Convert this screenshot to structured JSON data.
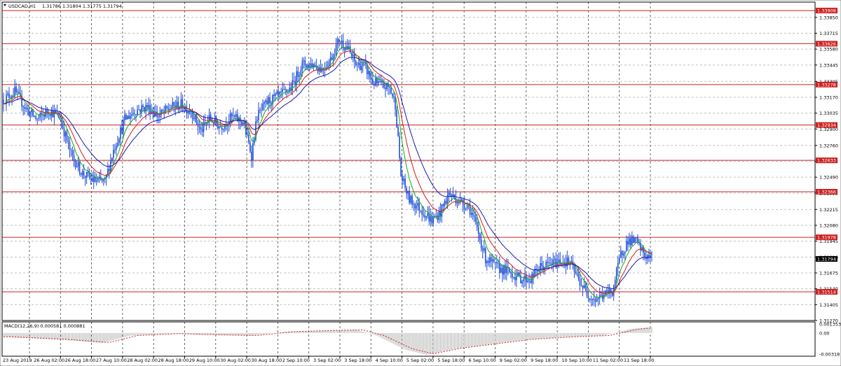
{
  "header": {
    "symbol_label": "USDCAD,H1",
    "ohlc_label": "1.31786 1.31804 1.31775 1.31794"
  },
  "macd": {
    "label": "MACD(12,26,9) 0.000581 0.000881",
    "ticks": [
      "0.001353",
      "0.00",
      "-0.00318"
    ]
  },
  "colors": {
    "background": "#ffffff",
    "frame": "#000000",
    "grid": "#c0c0c0",
    "candles": "#1f4fd8",
    "ma_fast": "#1aa51a",
    "ma_mid": "#d81c1c",
    "ma_slow": "#1b1bb0",
    "level_line": "#cc2020",
    "level_tag_bg": "#cc2020",
    "current_tag_bg": "#000000",
    "macd_hist": "#b8b8b8",
    "macd_signal": "#cc2020"
  },
  "chart_data": {
    "type": "candlestick",
    "title": "USDCAD,H1",
    "ylim": [
      1.3127,
      1.3398
    ],
    "price_ticks": [
      "1.33850",
      "1.33715",
      "1.33580",
      "1.33445",
      "1.33305",
      "1.33170",
      "1.33035",
      "1.32900",
      "1.32760",
      "1.32625",
      "1.32490",
      "1.32355",
      "1.32215",
      "1.32080",
      "1.31945",
      "1.31810",
      "1.31675",
      "1.31540",
      "1.31405",
      "1.31270"
    ],
    "levels": [
      "1.33908",
      "1.33626",
      "1.33278",
      "1.32934",
      "1.32633",
      "1.32366",
      "1.31978",
      "1.31514"
    ],
    "current_price": "1.31794",
    "x_labels": [
      "23 Aug 2019",
      "26 Aug 02:00",
      "26 Aug 18:00",
      "27 Aug 10:00",
      "28 Aug 02:00",
      "28 Aug 18:00",
      "29 Aug 10:00",
      "30 Aug 02:00",
      "30 Aug 18:00",
      "2 Sep 10:00",
      "3 Sep 02:00",
      "3 Sep 18:00",
      "4 Sep 10:00",
      "5 Sep 02:00",
      "5 Sep 18:00",
      "6 Sep 10:00",
      "9 Sep 02:00",
      "9 Sep 18:00",
      "10 Sep 10:00",
      "11 Sep 02:00",
      "11 Sep 18:00"
    ],
    "path_anchors": [
      [
        0,
        1.3315
      ],
      [
        8,
        1.3322
      ],
      [
        16,
        1.3307
      ],
      [
        24,
        1.3298
      ],
      [
        32,
        1.3306
      ],
      [
        40,
        1.33
      ],
      [
        48,
        1.3268
      ],
      [
        56,
        1.3252
      ],
      [
        64,
        1.3246
      ],
      [
        72,
        1.3245
      ],
      [
        78,
        1.3272
      ],
      [
        86,
        1.3298
      ],
      [
        94,
        1.3306
      ],
      [
        102,
        1.3309
      ],
      [
        110,
        1.3301
      ],
      [
        118,
        1.3308
      ],
      [
        126,
        1.3311
      ],
      [
        134,
        1.3304
      ],
      [
        140,
        1.3288
      ],
      [
        146,
        1.3299
      ],
      [
        154,
        1.3292
      ],
      [
        162,
        1.33
      ],
      [
        170,
        1.3296
      ],
      [
        176,
        1.3268
      ],
      [
        180,
        1.3301
      ],
      [
        188,
        1.3314
      ],
      [
        196,
        1.3318
      ],
      [
        204,
        1.3325
      ],
      [
        212,
        1.3345
      ],
      [
        220,
        1.3345
      ],
      [
        226,
        1.3341
      ],
      [
        232,
        1.3349
      ],
      [
        238,
        1.3366
      ],
      [
        244,
        1.3359
      ],
      [
        250,
        1.3345
      ],
      [
        256,
        1.3344
      ],
      [
        262,
        1.333
      ],
      [
        268,
        1.3327
      ],
      [
        274,
        1.3325
      ],
      [
        278,
        1.3311
      ],
      [
        282,
        1.325
      ],
      [
        288,
        1.323
      ],
      [
        296,
        1.3222
      ],
      [
        304,
        1.3212
      ],
      [
        310,
        1.3219
      ],
      [
        316,
        1.3235
      ],
      [
        324,
        1.3228
      ],
      [
        330,
        1.3225
      ],
      [
        336,
        1.3205
      ],
      [
        342,
        1.318
      ],
      [
        350,
        1.3172
      ],
      [
        358,
        1.3169
      ],
      [
        366,
        1.3163
      ],
      [
        374,
        1.3162
      ],
      [
        380,
        1.3172
      ],
      [
        388,
        1.3175
      ],
      [
        396,
        1.3178
      ],
      [
        402,
        1.3176
      ],
      [
        408,
        1.3162
      ],
      [
        414,
        1.315
      ],
      [
        420,
        1.3145
      ],
      [
        426,
        1.3149
      ],
      [
        432,
        1.3152
      ],
      [
        438,
        1.3183
      ],
      [
        443,
        1.3195
      ],
      [
        449,
        1.3194
      ],
      [
        455,
        1.3182
      ],
      [
        460,
        1.318
      ]
    ],
    "macd_anchors": [
      [
        0,
        -0.0006
      ],
      [
        40,
        -0.001
      ],
      [
        70,
        -0.0015
      ],
      [
        90,
        -0.0004
      ],
      [
        120,
        -0.0001
      ],
      [
        150,
        -0.0003
      ],
      [
        175,
        -0.0004
      ],
      [
        200,
        0.0002
      ],
      [
        230,
        0.0004
      ],
      [
        250,
        0.0005
      ],
      [
        265,
        -0.0004
      ],
      [
        285,
        -0.0025
      ],
      [
        300,
        -0.0033
      ],
      [
        320,
        -0.0024
      ],
      [
        345,
        -0.0017
      ],
      [
        370,
        -0.001
      ],
      [
        400,
        -0.0006
      ],
      [
        425,
        -0.0004
      ],
      [
        445,
        0.0006
      ],
      [
        460,
        0.0009
      ]
    ],
    "grid": true
  }
}
